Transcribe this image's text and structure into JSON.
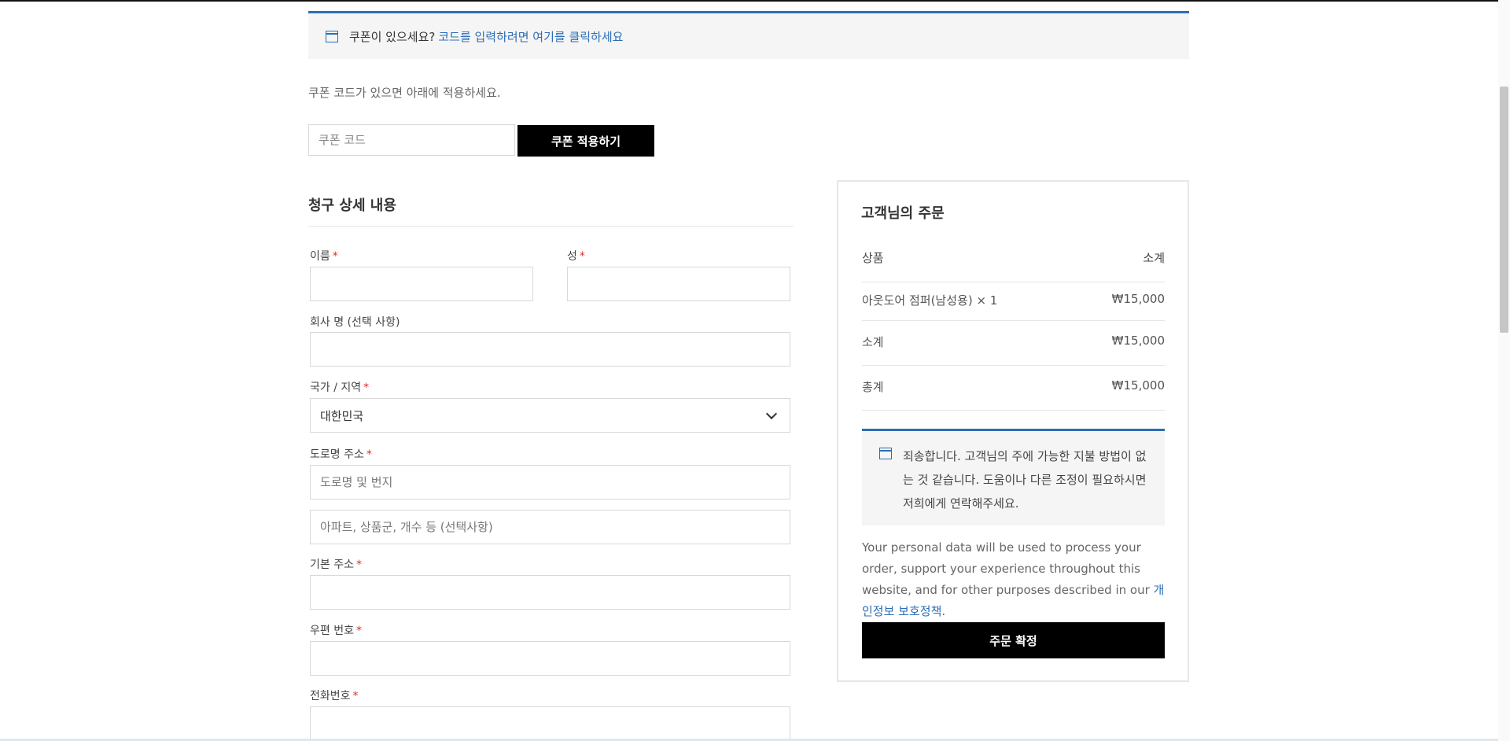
{
  "coupon_notice": {
    "text": "쿠폰이 있으세요?",
    "link_text": "코드를 입력하려면 여기를 클릭하세요"
  },
  "coupon": {
    "description": "쿠폰 코드가 있으면 아래에 적용하세요.",
    "input_placeholder": "쿠폰 코드",
    "apply_button": "쿠폰 적용하기"
  },
  "billing": {
    "title": "청구 상세 내용",
    "required_mark": "*",
    "fields": {
      "first_name": {
        "label": "이름",
        "value": ""
      },
      "last_name": {
        "label": "성",
        "value": ""
      },
      "company": {
        "label": "회사 명 (선택 사항)",
        "value": ""
      },
      "country": {
        "label": "국가 / 지역",
        "value": "대한민국"
      },
      "street": {
        "label": "도로명 주소",
        "placeholder_1": "도로명 및 번지",
        "placeholder_2": "아파트, 상품군, 개수 등 (선택사항)"
      },
      "city": {
        "label": "기본 주소",
        "value": ""
      },
      "postcode": {
        "label": "우편 번호",
        "value": ""
      },
      "phone": {
        "label": "전화번호",
        "value": ""
      }
    }
  },
  "order": {
    "title": "고객님의 주문",
    "header": {
      "product": "상품",
      "subtotal": "소계"
    },
    "item": {
      "name": "아웃도어 점퍼(남성용) × 1",
      "price": "₩15,000"
    },
    "subtotal": {
      "label": "소계",
      "value": "₩15,000"
    },
    "total": {
      "label": "총계",
      "value": "₩15,000"
    },
    "payment_notice": "죄송합니다. 고객님의 주에 가능한 지불 방법이 없는 것 같습니다. 도움이나 다른 조정이 필요하시면 저희에게 연락해주세요.",
    "privacy_text": "Your personal data will be used to process your order, support your experience throughout this website, and for other purposes described in our",
    "privacy_link": "개인정보 보호정책",
    "privacy_end": ".",
    "place_order_button": "주문 확정"
  },
  "colors": {
    "accent": "#2c6db5",
    "required": "#d93025",
    "button_bg": "#000000",
    "notice_bg": "#f5f5f5"
  }
}
